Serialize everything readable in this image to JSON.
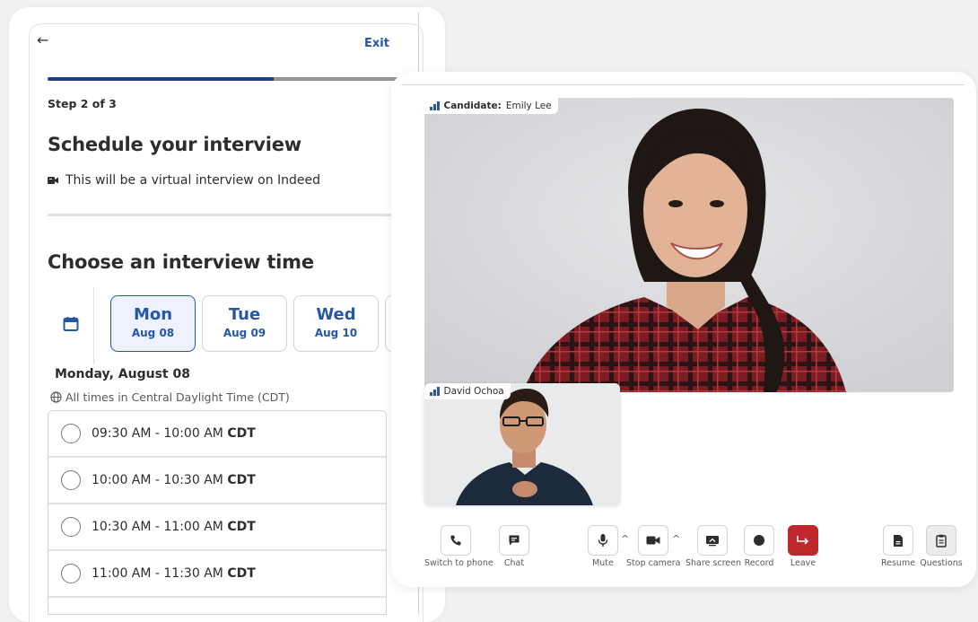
{
  "scheduler": {
    "back_icon": "arrow-left-icon",
    "exit_label": "Exit",
    "progress_fraction": 0.63,
    "step_label": "Step 2 of 3",
    "title": "Schedule your interview",
    "virtual_icon": "video-camera-icon",
    "virtual_text": "This will be a virtual interview on Indeed",
    "choose_title": "Choose an interview time",
    "calendar_icon": "calendar-icon",
    "days": [
      {
        "name": "Mon",
        "date": "Aug 08",
        "selected": true
      },
      {
        "name": "Tue",
        "date": "Aug 09",
        "selected": false
      },
      {
        "name": "Wed",
        "date": "Aug 10",
        "selected": false
      }
    ],
    "selected_date_title": "Monday, August 08",
    "timezone_icon": "globe-icon",
    "timezone_text": "All times in Central Daylight Time (CDT)",
    "slots": [
      {
        "time": "09:30 AM - 10:00 AM",
        "tz": "CDT"
      },
      {
        "time": "10:00 AM - 10:30 AM",
        "tz": "CDT"
      },
      {
        "time": "10:30 AM - 11:00 AM",
        "tz": "CDT"
      },
      {
        "time": "11:00 AM - 11:30 AM",
        "tz": "CDT"
      }
    ]
  },
  "video": {
    "main_participant": {
      "role_label": "Candidate:",
      "name": "Emily Lee",
      "signal_icon": "signal-bars-icon"
    },
    "pip_participant": {
      "name": "David Ochoa",
      "signal_icon": "signal-bars-icon"
    },
    "controls": {
      "switch_to_phone": {
        "label": "Switch to phone",
        "icon": "phone-icon"
      },
      "chat": {
        "label": "Chat",
        "icon": "chat-icon"
      },
      "mute": {
        "label": "Mute",
        "icon": "microphone-icon"
      },
      "stop_camera": {
        "label": "Stop camera",
        "icon": "video-camera-icon"
      },
      "share_screen": {
        "label": "Share screen",
        "icon": "share-screen-icon"
      },
      "record": {
        "label": "Record",
        "icon": "record-icon"
      },
      "leave": {
        "label": "Leave",
        "icon": "leave-arrow-icon"
      },
      "resume": {
        "label": "Resume",
        "icon": "document-icon"
      },
      "questions": {
        "label": "Questions",
        "icon": "clipboard-icon"
      }
    },
    "caret_icon": "chevron-up-icon"
  },
  "colors": {
    "accent_blue": "#2557a7",
    "progress_dark": "#1e3e7e",
    "leave_red": "#c0292b",
    "background": "#f2f1ef"
  }
}
